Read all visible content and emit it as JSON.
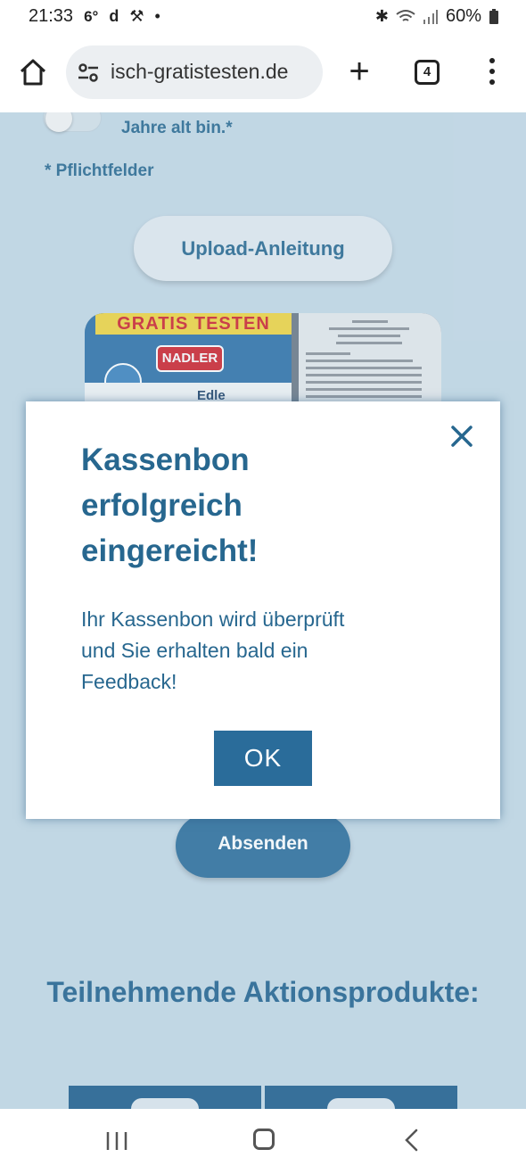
{
  "status_bar": {
    "time": "21:33",
    "temperature": "6°",
    "battery": "60%",
    "icons": [
      "d-icon",
      "tools-icon",
      "dot-icon",
      "bluetooth-icon",
      "wifi-icon",
      "signal-icon",
      "battery-icon"
    ]
  },
  "browser": {
    "url_text": "isch-gratistesten.de",
    "tab_count": "4",
    "icons": [
      "home-icon",
      "site-settings-icon",
      "plus-icon",
      "tabs-icon",
      "menu-icon"
    ]
  },
  "page": {
    "age_confirm_label": "Jahre alt bin.*",
    "age_toggle_on": false,
    "required_note": "* Pflichtfelder",
    "upload_button_label": "Upload-Anleitung",
    "photo": {
      "banner": "GRATIS TESTEN",
      "brand": "NADLER",
      "product_name": "Edle"
    },
    "submit_button_label": "Absenden",
    "products_heading": "Teilnehmende Aktionsprodukte:"
  },
  "modal": {
    "title_lines": [
      "Kassenbon",
      "erfolgreich",
      "eingereicht!"
    ],
    "message_lines": [
      "Ihr Kassenbon wird überprüft",
      "und Sie erhalten bald ein",
      "Feedback!"
    ],
    "ok_label": "OK"
  },
  "colors": {
    "page_background": "#c5d9e6",
    "brand_blue": "#27678f",
    "button_blue": "#2a6c9a"
  }
}
